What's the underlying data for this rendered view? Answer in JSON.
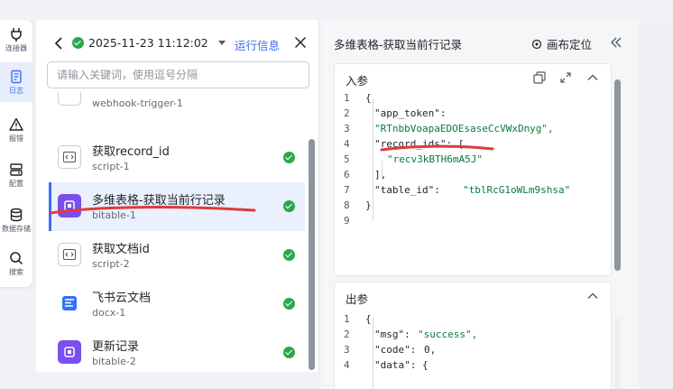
{
  "rail": {
    "items": [
      {
        "label": "连接器",
        "icon": "plug-icon"
      },
      {
        "label": "日志",
        "icon": "log-icon"
      },
      {
        "label": "报错",
        "icon": "warning-icon"
      },
      {
        "label": "配置",
        "icon": "config-icon"
      },
      {
        "label": "数据存储",
        "icon": "database-icon"
      },
      {
        "label": "搜索",
        "icon": "search-icon"
      }
    ]
  },
  "header": {
    "run_time": "2025-11-23 11:12:02",
    "run_info": "运行信息"
  },
  "search": {
    "placeholder": "请输入关键词，使用逗号分隔"
  },
  "nodes": [
    {
      "title": "",
      "subtitle": "webhook-trigger-1",
      "type": "trigger",
      "status": ""
    },
    {
      "title": "获取record_id",
      "subtitle": "script-1",
      "type": "script",
      "status": "success"
    },
    {
      "title": "多维表格-获取当前行记录",
      "subtitle": "bitable-1",
      "type": "bitable",
      "status": "success"
    },
    {
      "title": "获取文档id",
      "subtitle": "script-2",
      "type": "script",
      "status": "success"
    },
    {
      "title": "飞书云文档",
      "subtitle": "docx-1",
      "type": "docx",
      "status": "success"
    },
    {
      "title": "更新记录",
      "subtitle": "bitable-2",
      "type": "bitable",
      "status": "success"
    }
  ],
  "detail": {
    "title": "多维表格-获取当前行记录",
    "locate_label": "画布定位",
    "input": {
      "title": "入参",
      "lines": [
        {
          "n": "1",
          "text": "{"
        },
        {
          "n": "2",
          "key": "\"app_token\":",
          "value": ""
        },
        {
          "n": "3",
          "key": "",
          "value": "\"RTnbbVoapaEDOEsaseCcVWxDnyg\","
        },
        {
          "n": "4",
          "key": "\"record_ids\": [",
          "value": ""
        },
        {
          "n": "5",
          "key": "",
          "value": "\"recv3kBTH6mA5J\""
        },
        {
          "n": "6",
          "text": "],"
        },
        {
          "n": "7",
          "key": "\"table_id\":",
          "value": "\"tblRcG1oWLm9shsa\""
        },
        {
          "n": "8",
          "text": "}"
        },
        {
          "n": "9",
          "text": ""
        }
      ]
    },
    "output": {
      "title": "出参",
      "lines": [
        {
          "n": "1",
          "text": "{"
        },
        {
          "n": "2",
          "key": "\"msg\":",
          "value": "\"success\","
        },
        {
          "n": "3",
          "key": "\"code\":",
          "value": "0,"
        },
        {
          "n": "4",
          "key": "\"data\": {",
          "value": ""
        }
      ]
    }
  },
  "colors": {
    "accent": "#3d6cf6",
    "success": "#2aa84a",
    "annotation": "#e03a3a",
    "bitable": "#7b4ef0"
  }
}
